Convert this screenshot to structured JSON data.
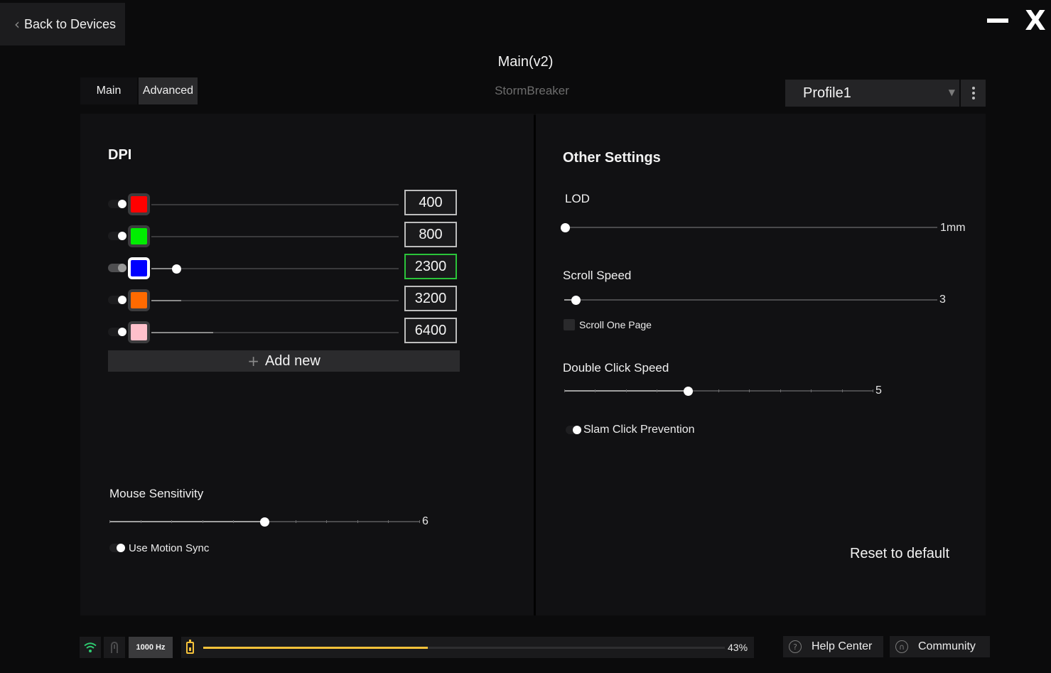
{
  "header": {
    "back_label": "Back to Devices",
    "page_title": "Main(v2)",
    "device_name": "StormBreaker",
    "tabs": [
      {
        "label": "Main"
      },
      {
        "label": "Advanced"
      }
    ],
    "profile": "Profile1"
  },
  "dpi": {
    "title": "DPI",
    "rows": [
      {
        "value": "400",
        "color": "#ff0000",
        "enabled": false,
        "selected": false,
        "level": 0.0
      },
      {
        "value": "800",
        "color": "#00ee00",
        "enabled": false,
        "selected": false,
        "level": 0.0
      },
      {
        "value": "2300",
        "color": "#0000ff",
        "enabled": true,
        "selected": true,
        "level": 0.1
      },
      {
        "value": "3200",
        "color": "#ff6a00",
        "enabled": false,
        "selected": false,
        "level": 0.12
      },
      {
        "value": "6400",
        "color": "#ffc0cb",
        "enabled": false,
        "selected": false,
        "level": 0.25
      }
    ],
    "add_new_label": "Add new"
  },
  "mouse_sensitivity": {
    "label": "Mouse Sensitivity",
    "value": "6",
    "level": 0.5,
    "motion_sync_label": "Use Motion Sync"
  },
  "other_settings": {
    "title": "Other Settings",
    "lod": {
      "label": "LOD",
      "value": "1mm",
      "level": 0.0
    },
    "scroll_speed": {
      "label": "Scroll Speed",
      "value": "3",
      "level": 0.03,
      "scroll_one_page_label": "Scroll One Page"
    },
    "double_click_speed": {
      "label": "Double Click Speed",
      "value": "5",
      "level": 0.4
    },
    "slam_click_label": "Slam Click Prevention",
    "reset_label": "Reset to default"
  },
  "status_bar": {
    "polling_rate": "1000 Hz",
    "battery_percent": "43%",
    "battery_level": 0.43,
    "help_label": "Help Center",
    "community_label": "Community"
  }
}
